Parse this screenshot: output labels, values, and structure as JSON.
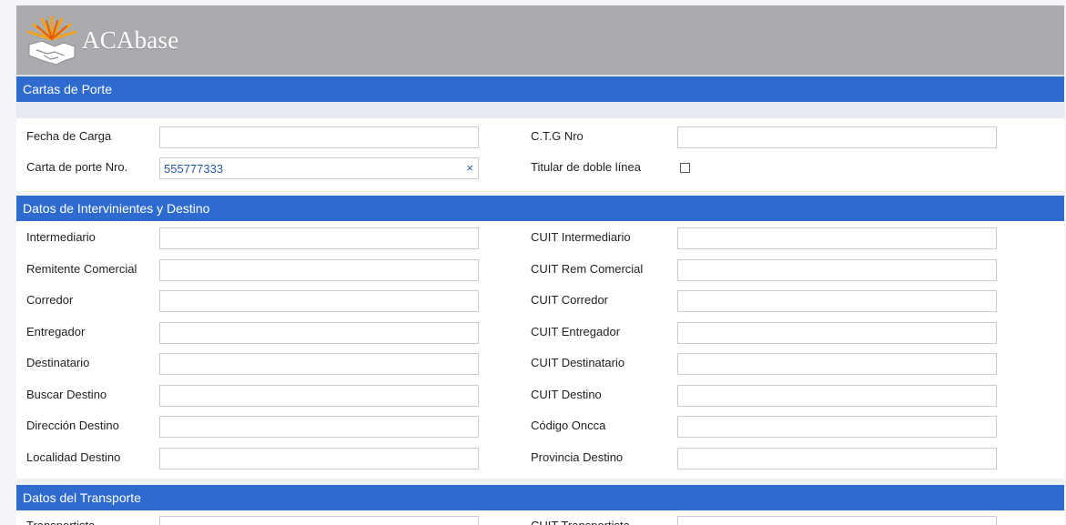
{
  "header": {
    "logo_text": "ACAbase"
  },
  "sections": {
    "cartas": {
      "title": "Cartas de Porte"
    },
    "intervinientes": {
      "title": "Datos de Intervinientes y Destino"
    },
    "transporte": {
      "title": "Datos del Transporte"
    }
  },
  "cartas_form": {
    "fecha_carga": {
      "label": "Fecha de Carga",
      "value": ""
    },
    "ctg_nro": {
      "label": "C.T.G Nro",
      "value": ""
    },
    "carta_porte_nro": {
      "label": "Carta de porte Nro.",
      "value": "555777333",
      "clear_icon": "×"
    },
    "titular_doble_linea": {
      "label": "Titular de doble línea",
      "checked": false
    }
  },
  "intervinientes_form": {
    "left": [
      {
        "label": "Intermediario",
        "value": ""
      },
      {
        "label": "Remitente Comercial",
        "value": ""
      },
      {
        "label": "Corredor",
        "value": ""
      },
      {
        "label": "Entregador",
        "value": ""
      },
      {
        "label": "Destinatario",
        "value": ""
      },
      {
        "label": "Buscar Destino",
        "value": ""
      },
      {
        "label": "Dirección Destino",
        "value": ""
      },
      {
        "label": "Localidad Destino",
        "value": ""
      }
    ],
    "right": [
      {
        "label": "CUIT Intermediario",
        "value": ""
      },
      {
        "label": "CUIT Rem Comercial",
        "value": ""
      },
      {
        "label": "CUIT Corredor",
        "value": ""
      },
      {
        "label": "CUIT Entregador",
        "value": ""
      },
      {
        "label": "CUIT Destinatario",
        "value": ""
      },
      {
        "label": "CUIT Destino",
        "value": ""
      },
      {
        "label": "Código Oncca",
        "value": ""
      },
      {
        "label": "Provincia Destino",
        "value": ""
      }
    ]
  },
  "transporte_form": {
    "left": [
      {
        "label": "Transportista",
        "value": ""
      }
    ],
    "right": [
      {
        "label": "CUIT Transportista",
        "value": ""
      }
    ]
  },
  "colors": {
    "section_bar": "#2f6bce",
    "header_bg": "#a9abae",
    "input_text": "#2a58a8"
  }
}
